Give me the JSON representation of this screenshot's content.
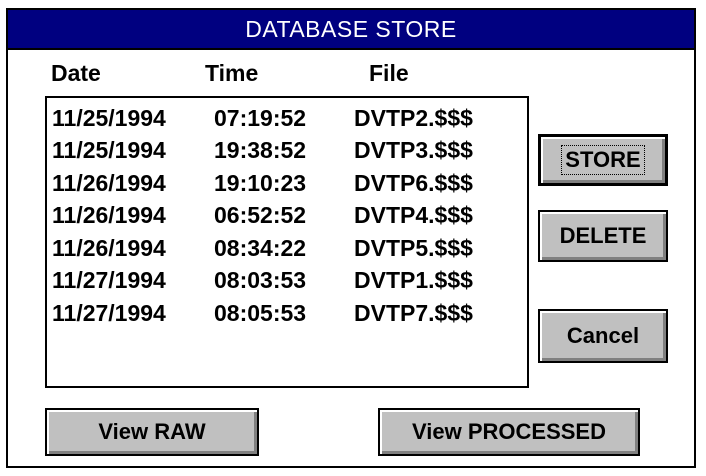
{
  "window": {
    "title": "DATABASE STORE"
  },
  "columns": {
    "date": "Date",
    "time": "Time",
    "file": "File"
  },
  "records": [
    {
      "date": "11/25/1994",
      "time": "07:19:52",
      "file": "DVTP2.$$$"
    },
    {
      "date": "11/25/1994",
      "time": "19:38:52",
      "file": "DVTP3.$$$"
    },
    {
      "date": "11/26/1994",
      "time": "19:10:23",
      "file": "DVTP6.$$$"
    },
    {
      "date": "11/26/1994",
      "time": "06:52:52",
      "file": "DVTP4.$$$"
    },
    {
      "date": "11/26/1994",
      "time": "08:34:22",
      "file": "DVTP5.$$$"
    },
    {
      "date": "11/27/1994",
      "time": "08:03:53",
      "file": "DVTP1.$$$"
    },
    {
      "date": "11/27/1994",
      "time": "08:05:53",
      "file": "DVTP7.$$$"
    }
  ],
  "buttons": {
    "store": "STORE",
    "delete": "DELETE",
    "cancel": "Cancel",
    "view_raw": "View RAW",
    "view_processed": "View PROCESSED"
  },
  "colors": {
    "titlebar": "#000080",
    "button_face": "#c0c0c0"
  }
}
